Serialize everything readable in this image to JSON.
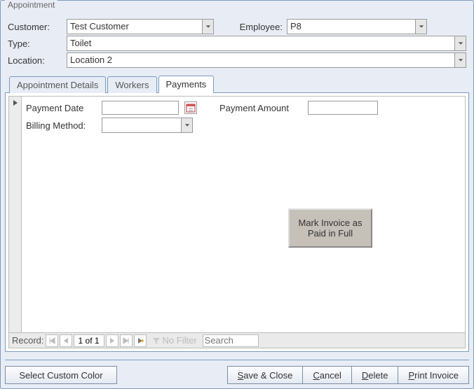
{
  "window": {
    "title": "Appointment"
  },
  "header": {
    "labels": {
      "customer": "Customer:",
      "employee": "Employee:",
      "type": "Type:",
      "location": "Location:"
    },
    "customer": "Test Customer",
    "employee": "P8",
    "type": "Toilet",
    "location": "Location 2"
  },
  "tabs": [
    {
      "label": "Appointment Details"
    },
    {
      "label": "Workers"
    },
    {
      "label": "Payments"
    }
  ],
  "payments": {
    "labels": {
      "payment_date": "Payment Date",
      "payment_amount": "Payment Amount",
      "billing_method": "Billing Method:"
    },
    "payment_date": "",
    "payment_amount": "",
    "billing_method": "",
    "mark_paid_label": "Mark Invoice as Paid in Full"
  },
  "nav": {
    "label": "Record:",
    "position": "1 of 1",
    "no_filter": "No Filter",
    "search_placeholder": "Search"
  },
  "actions": {
    "select_color": "Select Custom Color",
    "save_close": "Save & Close",
    "cancel": "Cancel",
    "delete": "Delete",
    "print_invoice": "Print Invoice"
  }
}
